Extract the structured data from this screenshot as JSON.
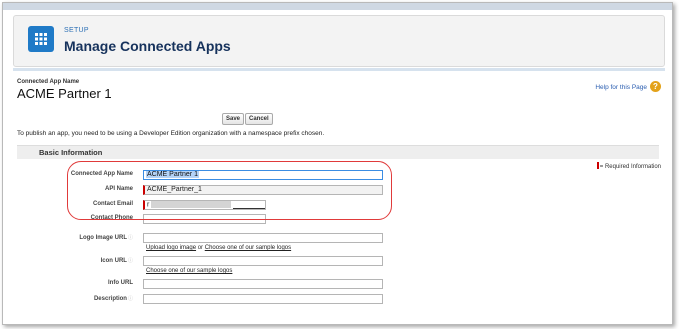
{
  "header": {
    "setup_label": "SETUP",
    "title": "Manage Connected Apps",
    "icon": "grid-icon",
    "accent_color": "#1f7ac7"
  },
  "context": {
    "label": "Connected App Name",
    "value": "ACME Partner 1",
    "help_link": "Help for this Page",
    "help_icon": "question-icon"
  },
  "buttons": {
    "save": "Save",
    "cancel": "Cancel"
  },
  "info_text": "To publish an app, you need to be using a Developer Edition organization with a namespace prefix chosen.",
  "section": {
    "title": "Basic Information",
    "required_legend": "= Required Information"
  },
  "form": {
    "connected_app_name": {
      "label": "Connected App Name",
      "value": "ACME Partner 1"
    },
    "api_name": {
      "label": "API Name",
      "value": "ACME_Partner_1"
    },
    "contact_email": {
      "label": "Contact Email",
      "value": "r"
    },
    "contact_phone": {
      "label": "Contact Phone",
      "value": ""
    },
    "logo_image_url": {
      "label": "Logo Image URL",
      "value": ""
    },
    "icon_url": {
      "label": "Icon URL",
      "value": ""
    },
    "info_url": {
      "label": "Info URL",
      "value": ""
    },
    "description": {
      "label": "Description",
      "value": ""
    },
    "info_glyph": "ⓘ"
  },
  "links": {
    "upload_logo": "Upload logo image",
    "or_text": "or",
    "choose_sample_logos": "Choose one of our sample logos",
    "choose_sample_logos_icon": "Choose one of our sample logos"
  }
}
